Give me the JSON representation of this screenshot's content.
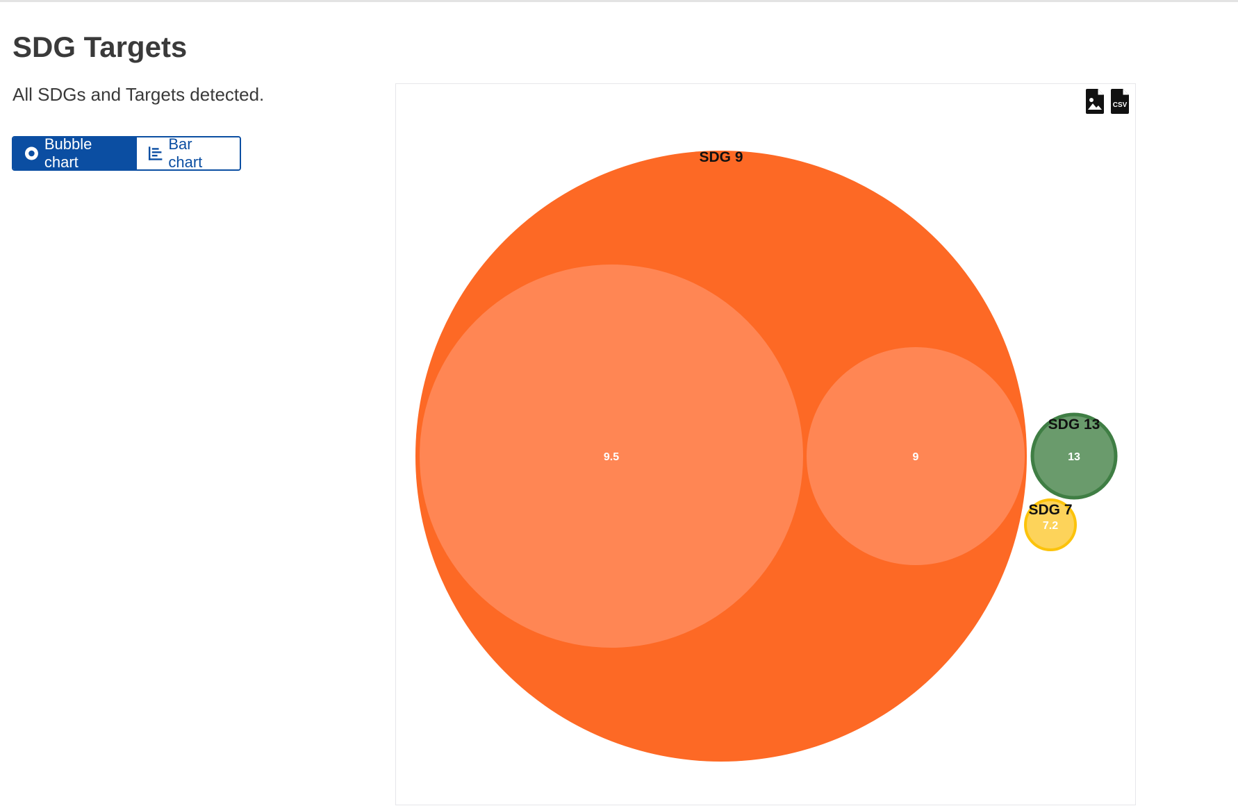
{
  "page": {
    "title": "SDG Targets",
    "description": "All SDGs and Targets detected."
  },
  "view_toggle": {
    "bubble_label": "Bubble chart",
    "bar_label": "Bar chart",
    "active": "bubble"
  },
  "toolbar": {
    "image_icon": "image-file-icon",
    "csv_icon": "csv-file-icon",
    "csv_text": "CSV"
  },
  "colors": {
    "primary": "#0b4ea2",
    "sdg9": "#fd6925",
    "sdg9_target": "#ff8654",
    "sdg13": "#3f7e44",
    "sdg13_fill": "#6a9b6c",
    "sdg7": "#fcc30b",
    "sdg7_fill": "#fdd35a"
  },
  "chart_data": {
    "type": "bubble",
    "groups": [
      {
        "label": "SDG 9",
        "targets": [
          {
            "label": "9.5",
            "weight": 0.64
          },
          {
            "label": "9",
            "weight": 0.36
          }
        ]
      },
      {
        "label": "SDG 13",
        "targets": [
          {
            "label": "13",
            "weight": 1
          }
        ]
      },
      {
        "label": "SDG 7",
        "targets": [
          {
            "label": "7.2",
            "weight": 1
          }
        ]
      }
    ]
  }
}
